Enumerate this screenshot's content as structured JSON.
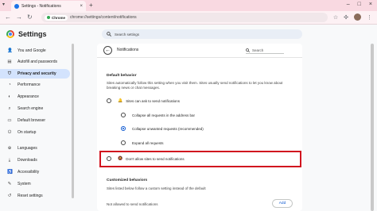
{
  "browser": {
    "tab_title": "Settings - Notifications",
    "tab_close": "×",
    "new_tab": "+",
    "tab_menu": "▾",
    "chip_label": "Chrome",
    "url": "chrome://settings/content/notifications",
    "window_controls": [
      "–",
      "□",
      "×"
    ]
  },
  "settings": {
    "title": "Settings",
    "search_placeholder": "Search settings"
  },
  "sidebar": {
    "items": [
      {
        "label": "You and Google",
        "icon": "person-icon"
      },
      {
        "label": "Autofill and passwords",
        "icon": "autofill-icon"
      },
      {
        "label": "Privacy and security",
        "icon": "shield-icon",
        "active": true
      },
      {
        "label": "Performance",
        "icon": "speedometer-icon"
      },
      {
        "label": "Appearance",
        "icon": "palette-icon"
      },
      {
        "label": "Search engine",
        "icon": "search-icon"
      },
      {
        "label": "Default browser",
        "icon": "browser-icon"
      },
      {
        "label": "On startup",
        "icon": "power-icon"
      },
      {
        "label": "Languages",
        "icon": "globe-icon"
      },
      {
        "label": "Downloads",
        "icon": "download-icon"
      },
      {
        "label": "Accessibility",
        "icon": "accessibility-icon"
      },
      {
        "label": "System",
        "icon": "wrench-icon"
      },
      {
        "label": "Reset settings",
        "icon": "reset-icon"
      }
    ]
  },
  "page": {
    "title": "Notifications",
    "search_placeholder": "Search",
    "default_behavior": {
      "heading": "Default behavior",
      "description": "Sites automatically follow this setting when you visit them. Sites usually send notifications to let you know about breaking news or chat messages.",
      "options": {
        "can_ask": "Sites can ask to send notifications",
        "collapse_all": "Collapse all requests in the address bar",
        "collapse_unwanted": "Collapse unwanted requests (recommended)",
        "expand_all": "Expand all requests",
        "dont_allow": "Don't allow sites to send notifications"
      }
    },
    "customized": {
      "heading": "Customized behaviors",
      "description": "Sites listed below follow a custom setting instead of the default",
      "not_allowed_label": "Not allowed to send notifications",
      "add_button": "Add"
    }
  },
  "colors": {
    "accent": "#0b57d0",
    "highlight_border": "#d1121e",
    "sidebar_active": "#d3e3fd"
  }
}
